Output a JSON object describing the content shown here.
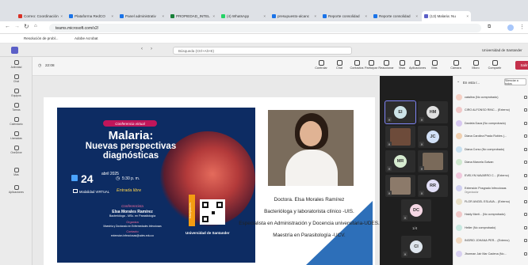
{
  "browser": {
    "tabs": [
      {
        "label": "Correo: Coordinación",
        "color": "#d93025"
      },
      {
        "label": "Plataforma RedCO",
        "color": "#1a73e8"
      },
      {
        "label": "Panel administrativ",
        "color": "#1a73e8"
      },
      {
        "label": "PROPIEDAD_INTEL",
        "color": "#188038"
      },
      {
        "label": "(4) WhatsApp",
        "color": "#25d366"
      },
      {
        "label": "presupuesto-alcanc",
        "color": "#1a73e8"
      },
      {
        "label": "Reporte consolidad",
        "color": "#1a73e8"
      },
      {
        "label": "Reporte consolidad",
        "color": "#1a73e8"
      },
      {
        "label": "(13) Malaria: Nu",
        "color": "#5b5fc7",
        "active": true
      }
    ],
    "url": "teams.microsoft.com/v2/",
    "bookmarks": [
      "Resolución de probl...",
      "Adobe Acrobat"
    ]
  },
  "teams": {
    "search_placeholder": "Búsqueda (Ctrl+Alt+E)",
    "org": "Universidad de Santander",
    "meeting_time": "22:08",
    "toolbar": [
      "Controlar",
      "Chat",
      "Contactos",
      "Participar",
      "Reaccionar",
      "Vista",
      "Aplicaciones",
      "Más",
      "Cámara",
      "Micro",
      "Compartir"
    ],
    "leave": "Salir",
    "rail": [
      "Actividad",
      "Chat",
      "Equipos",
      "Tareas",
      "Calendario",
      "Llamadas",
      "OneDrive",
      "Más",
      "Aplicaciones"
    ]
  },
  "slide": {
    "poster": {
      "banner": "Conferencia virtual",
      "title1": "Malaria:",
      "title2": "Nuevas perspectivas diagnósticas",
      "day": "24",
      "month": "abril 2025",
      "time": "5:30 p. m.",
      "modality": "Modalidad VIRTUAL",
      "free": "Entrada libre",
      "conferencista_label": "Conferencista",
      "speaker": "Elsa Morales Ramírez",
      "speaker_title": "Bacterióloga - MSc. en Parasitología",
      "organiza_label": "Organiza",
      "organiza": "Maestría y Doctorado en Enfermedades Infecciosas",
      "contacto_label": "Contacto",
      "email": "extension.infecciosas@udes.edu.co",
      "inscripcion": "Inscripciones",
      "university": "Universidad de Santander"
    },
    "cv": [
      "Doctora. Elsa Morales Ramírez",
      "Bacterióloga y laboratorista clínico -UIS.",
      "Especialista en Administración y Docencia universitaria-UDES.",
      "Maestría en Parasitología -UCV."
    ]
  },
  "grid": {
    "tiles": [
      {
        "initials": "EI",
        "color": "#cce3e8",
        "highlight": true
      },
      {
        "initials": "HM",
        "color": "#e0e0e0"
      },
      {
        "initials": "",
        "color": "#6d4b3a",
        "photo": true
      },
      {
        "initials": "JC",
        "color": "#d2e1f7"
      },
      {
        "initials": "MR",
        "color": "#d6ebd0"
      },
      {
        "initials": "",
        "color": "#7a6a5a",
        "photo": true
      },
      {
        "initials": "",
        "color": "#8c7a6a",
        "photo": true
      },
      {
        "initials": "RR",
        "color": "#e2dff7"
      },
      {
        "initials": "DC",
        "color": "#f5d7e4"
      },
      {
        "initials": "CI",
        "color": "#dfe6ee"
      }
    ],
    "pager": "1/4"
  },
  "people": {
    "header": "En esta r...",
    "mute_all": "Silenciar a todos",
    "rows": [
      {
        "name": "catalina (No comprobado)",
        "color": "#f5d0c5"
      },
      {
        "name": "CIRO ALFONSO RINC... (Externo)",
        "color": "#f0c8c8"
      },
      {
        "name": "Daniela Daza (No comprobado)",
        "color": "#d7c8f0"
      },
      {
        "name": "Diana Carolina Prada Robles (...",
        "color": "#f0d0b0"
      },
      {
        "name": "Diana Corso (No comprobado)",
        "color": "#c8e0f0"
      },
      {
        "name": "Diana Marcela Galvan",
        "color": "#cfe8cf"
      },
      {
        "name": "EVELYN NAVARRO C... (Externo)",
        "color": "#f0c8dc"
      },
      {
        "name": "Extensión Posgrado Infecciosas",
        "sub": "Organizador",
        "color": "#d0d0f0"
      },
      {
        "name": "FLOR ANGEL ESLAVA... (Externo)",
        "color": "#e8e0c8"
      },
      {
        "name": "Haidy Marti... (No comprobado)",
        "color": "#f0c8c8"
      },
      {
        "name": "Heiler (No comprobado)",
        "color": "#c8e8e0"
      },
      {
        "name": "INGRID JOHANA PER... (Externo)",
        "color": "#f0d8c0"
      },
      {
        "name": "Jhorman Jair Mar Cadena (No...",
        "color": "#d8d0f0"
      }
    ]
  }
}
